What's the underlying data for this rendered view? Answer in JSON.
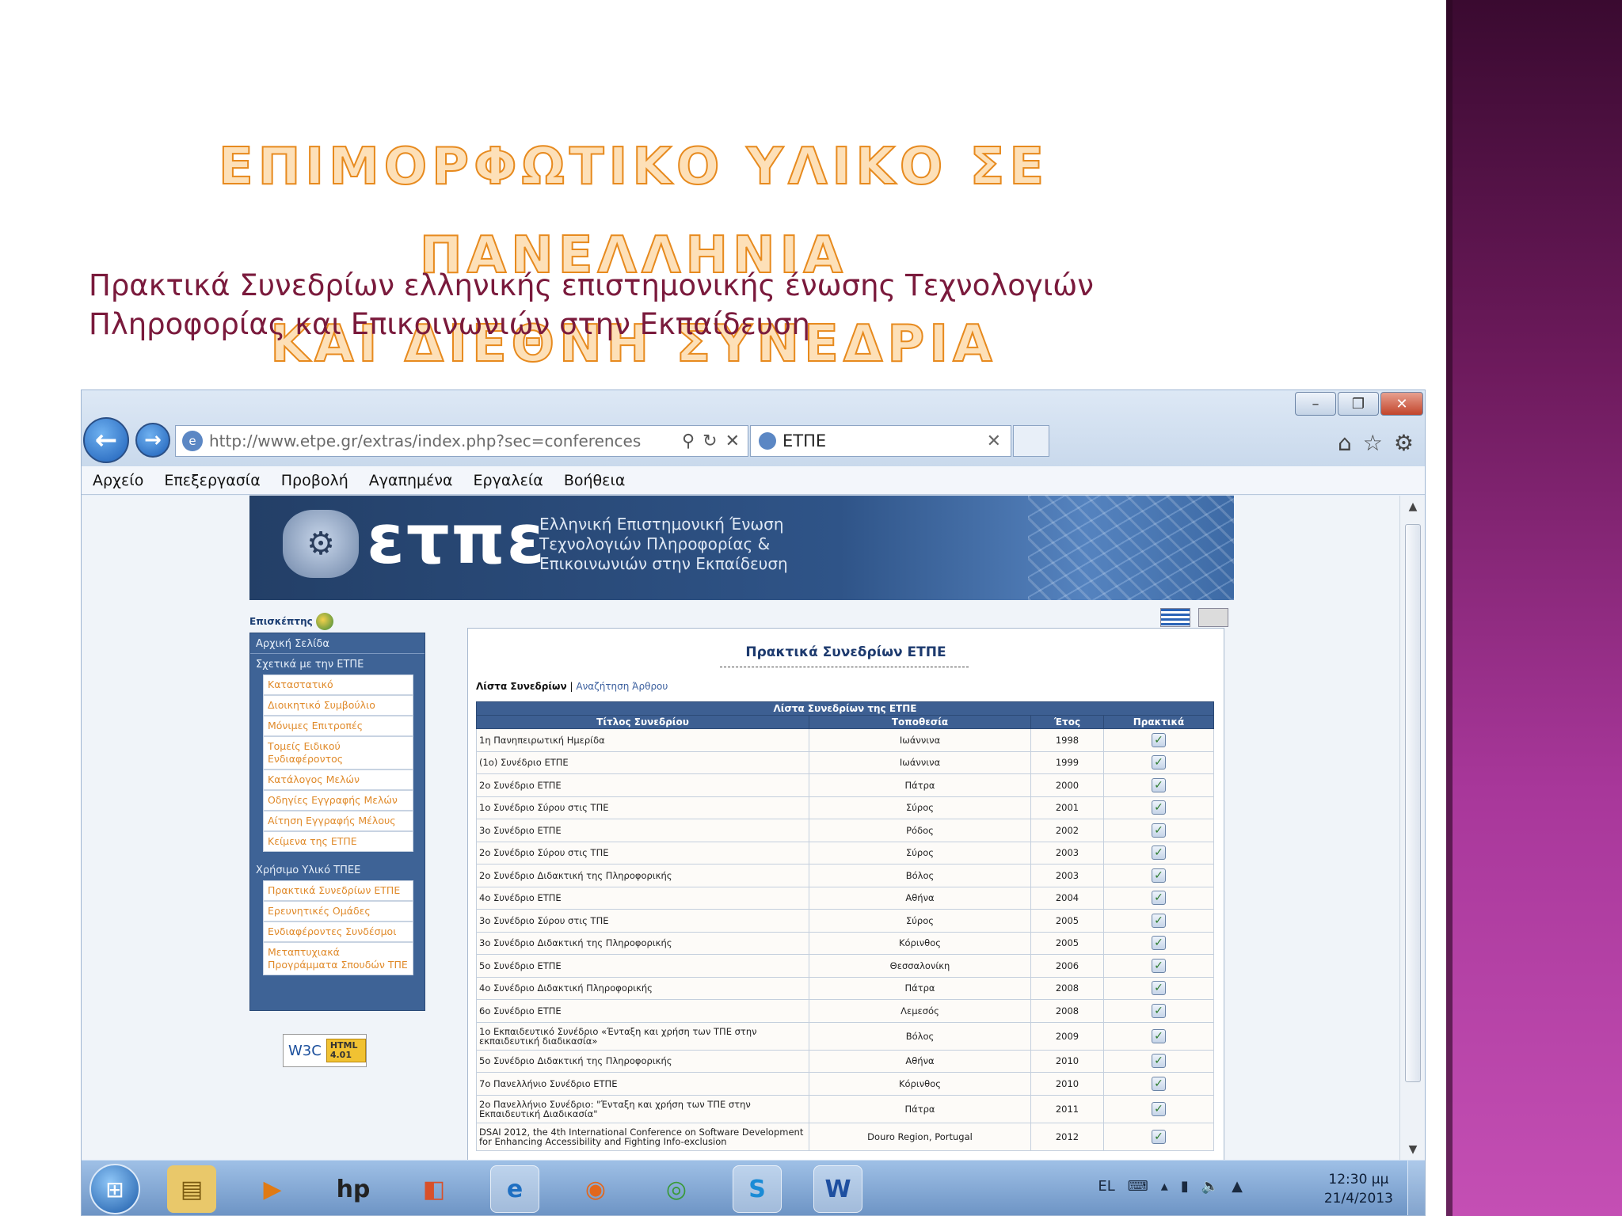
{
  "slide": {
    "title_line1": "ΕΠΙΜΟΡΦΩΤΙΚΟ ΥΛΙΚΟ ΣΕ ΠΑΝΕΛΛΗΝΙΑ",
    "title_line2": "ΚΑΙ ΔΙΕΘΝΗ ΣΥΝΕΔΡΙΑ",
    "subtitle_line1": "Πρακτικά Συνεδρίων ελληνικής επιστημονικής ένωσης Τεχνολογιών",
    "subtitle_line2": "Πληροφορίας και Επικοινωνιών στην Εκπαίδευση",
    "accent_band_color": "#8e2b7e"
  },
  "browser": {
    "url": "http://www.etpe.gr/extras/index.php?sec=conferences",
    "tab_title": "ΕΤΠΕ",
    "menu": [
      "Αρχείο",
      "Επεξεργασία",
      "Προβολή",
      "Αγαπημένα",
      "Εργαλεία",
      "Βοήθεια"
    ],
    "icons": [
      "back-icon",
      "forward-icon",
      "search-icon",
      "refresh-icon",
      "close-icon",
      "home-icon",
      "favorites-icon",
      "settings-icon"
    ]
  },
  "site": {
    "logo": "ετπε",
    "tagline_line1": "Ελληνική Επιστημονική Ένωση",
    "tagline_line2": "Τεχνολογιών Πληροφορίας &",
    "tagline_line3": "Επικοινωνιών στην Εκπαίδευση",
    "visitor_label": "Επισκέπτης",
    "sidebar": {
      "home": "Αρχική Σελίδα",
      "about_header": "Σχετικά με την ΕΤΠΕ",
      "about_items": [
        "Καταστατικό",
        "Διοικητικό Συμβούλιο",
        "Μόνιμες Επιτροπές",
        "Τομείς Ειδικού Ενδιαφέροντος",
        "Κατάλογος Μελών",
        "Οδηγίες Εγγραφής Μελών",
        "Αίτηση Εγγραφής Μέλους",
        "Κείμενα της ΕΤΠΕ"
      ],
      "material_header": "Χρήσιμο Υλικό ΤΠΕΕ",
      "material_items": [
        "Πρακτικά Συνεδρίων ΕΤΠΕ",
        "Ερευνητικές Ομάδες",
        "Ενδιαφέροντες Συνδέσμοι",
        "Μεταπτυχιακά Προγράμματα Σπουδών ΤΠΕ"
      ]
    },
    "w3c_text": "W3C",
    "w3c_badge": "HTML 4.01"
  },
  "content": {
    "title": "Πρακτικά Συνεδρίων ΕΤΠΕ",
    "link_list": "Λίστα Συνεδρίων",
    "separator": "|",
    "link_search": "Αναζήτηση Άρθρου",
    "table_caption": "Λίστα Συνεδρίων της ΕΤΠΕ",
    "columns": [
      "Τίτλος Συνεδρίου",
      "Τοποθεσία",
      "Έτος",
      "Πρακτικά"
    ],
    "rows": [
      {
        "title": "1η Πανηπειρωτική Ημερίδα",
        "place": "Ιωάννινα",
        "year": "1998"
      },
      {
        "title": "(1ο) Συνέδριο ΕΤΠΕ",
        "place": "Ιωάννινα",
        "year": "1999"
      },
      {
        "title": "2ο Συνέδριο ΕΤΠΕ",
        "place": "Πάτρα",
        "year": "2000"
      },
      {
        "title": "1ο Συνέδριο Σύρου στις ΤΠΕ",
        "place": "Σύρος",
        "year": "2001"
      },
      {
        "title": "3ο Συνέδριο ΕΤΠΕ",
        "place": "Ρόδος",
        "year": "2002"
      },
      {
        "title": "2ο Συνέδριο Σύρου στις ΤΠΕ",
        "place": "Σύρος",
        "year": "2003"
      },
      {
        "title": "2ο Συνέδριο Διδακτική της Πληροφορικής",
        "place": "Βόλος",
        "year": "2003"
      },
      {
        "title": "4ο Συνέδριο ΕΤΠΕ",
        "place": "Αθήνα",
        "year": "2004"
      },
      {
        "title": "3ο Συνέδριο Σύρου στις ΤΠΕ",
        "place": "Σύρος",
        "year": "2005"
      },
      {
        "title": "3ο Συνέδριο Διδακτική της Πληροφορικής",
        "place": "Κόρινθος",
        "year": "2005"
      },
      {
        "title": "5ο Συνέδριο ΕΤΠΕ",
        "place": "Θεσσαλονίκη",
        "year": "2006"
      },
      {
        "title": "4ο Συνέδριο Διδακτική Πληροφορικής",
        "place": "Πάτρα",
        "year": "2008"
      },
      {
        "title": "6ο Συνέδριο ΕΤΠΕ",
        "place": "Λεμεσός",
        "year": "2008"
      },
      {
        "title": "1ο Εκπαιδευτικό Συνέδριο «Ένταξη και χρήση των ΤΠΕ στην εκπαιδευτική διαδικασία»",
        "place": "Βόλος",
        "year": "2009"
      },
      {
        "title": "5ο Συνέδριο Διδακτική της Πληροφορικής",
        "place": "Αθήνα",
        "year": "2010"
      },
      {
        "title": "7ο Πανελλήνιο Συνέδριο ΕΤΠΕ",
        "place": "Κόρινθος",
        "year": "2010"
      },
      {
        "title": "2ο Πανελλήνιο Συνέδριο: \"Ένταξη και χρήση των ΤΠΕ στην Εκπαιδευτική Διαδικασία\"",
        "place": "Πάτρα",
        "year": "2011"
      },
      {
        "title": "DSAI 2012, the 4th International Conference on Software Development for Enhancing Accessibility and Fighting Info-exclusion",
        "place": "Douro Region, Portugal",
        "year": "2012"
      }
    ]
  },
  "taskbar": {
    "apps": [
      "start-button",
      "file-explorer-icon",
      "media-player-icon",
      "hp-icon",
      "office-icon",
      "internet-explorer-icon",
      "firefox-icon",
      "chrome-icon",
      "skype-icon",
      "word-icon"
    ],
    "lang": "EL",
    "time": "12:30 μμ",
    "date": "21/4/2013"
  }
}
